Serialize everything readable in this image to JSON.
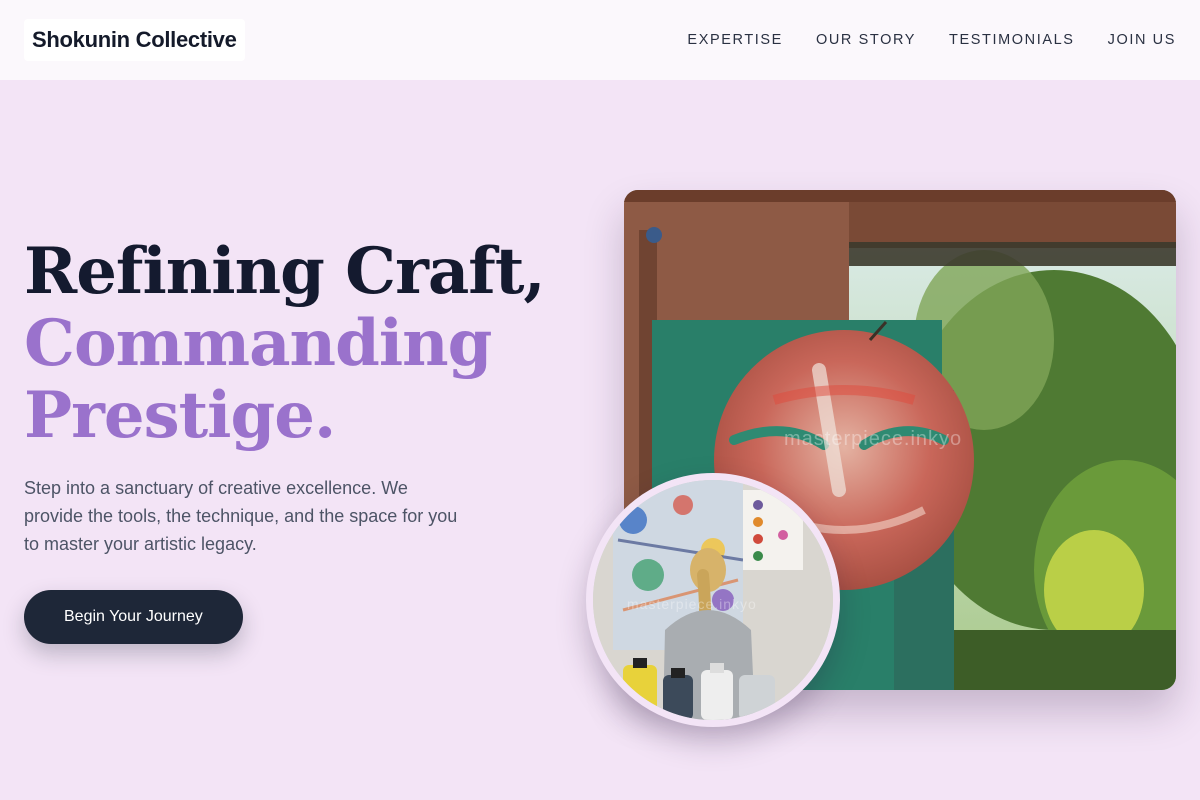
{
  "header": {
    "brand": "Shokunin Collective",
    "nav": [
      {
        "label": "EXPERTISE"
      },
      {
        "label": "OUR STORY"
      },
      {
        "label": "TESTIMONIALS"
      },
      {
        "label": "JOIN US"
      }
    ]
  },
  "hero": {
    "headline_line1": "Refining Craft,",
    "headline_line2": "Commanding",
    "headline_line3": "Prestige.",
    "description": "Step into a sanctuary of creative excellence. We provide the tools, the technique, and the space for you to master your artistic legacy.",
    "cta_label": "Begin Your Journey"
  },
  "images": {
    "main_watermark": "masterpiece.inkyo",
    "circle_watermark": "masterpiece.inkyo"
  },
  "colors": {
    "background": "#f3e4f6",
    "accent": "#9a72cc",
    "dark": "#1e2738"
  }
}
